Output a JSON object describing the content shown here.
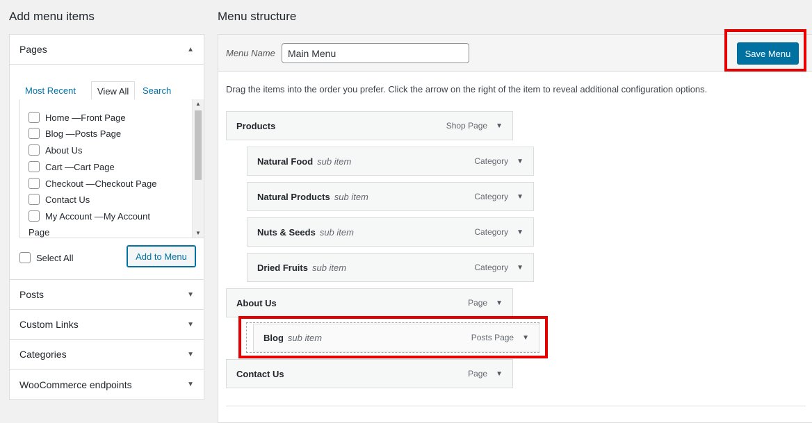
{
  "left_heading": "Add menu items",
  "right_heading": "Menu structure",
  "accordion": {
    "pages": {
      "title": "Pages",
      "arrow": "▲",
      "tabs": [
        "Most Recent",
        "View All",
        "Search"
      ],
      "items": [
        {
          "label": "Home — ",
          "bold": "Front Page"
        },
        {
          "label": "Blog — ",
          "bold": "Posts Page"
        },
        {
          "label": "About Us",
          "bold": ""
        },
        {
          "label": "Cart — ",
          "bold": "Cart Page"
        },
        {
          "label": "Checkout — ",
          "bold": "Checkout Page"
        },
        {
          "label": "Contact Us",
          "bold": ""
        },
        {
          "label": "My Account — ",
          "bold": "My Account"
        },
        {
          "label": "Page",
          "bold": ""
        }
      ],
      "select_all": "Select All",
      "add_button": "Add to Menu"
    },
    "sections": [
      "Posts",
      "Custom Links",
      "Categories",
      "WooCommerce endpoints"
    ]
  },
  "menu": {
    "name_label": "Menu Name",
    "name_value": "Main Menu",
    "save_button": "Save Menu",
    "instructions": "Drag the items into the order you prefer. Click the arrow on the right of the item to reveal additional configuration options.",
    "items": [
      {
        "title": "Products",
        "sub": "",
        "type": "Shop Page",
        "depth": 0
      },
      {
        "title": "Natural Food",
        "sub": "sub item",
        "type": "Category",
        "depth": 1
      },
      {
        "title": "Natural Products",
        "sub": "sub item",
        "type": "Category",
        "depth": 1
      },
      {
        "title": "Nuts & Seeds",
        "sub": "sub item",
        "type": "Category",
        "depth": 1
      },
      {
        "title": "Dried Fruits",
        "sub": "sub item",
        "type": "Category",
        "depth": 1
      },
      {
        "title": "About Us",
        "sub": "",
        "type": "Page",
        "depth": 0
      },
      {
        "title": "Blog",
        "sub": "sub item",
        "type": "Posts Page",
        "depth": 1
      },
      {
        "title": "Contact Us",
        "sub": "",
        "type": "Page",
        "depth": 0
      }
    ]
  },
  "colors": {
    "accent": "#0071a1",
    "highlight": "#e50000"
  }
}
